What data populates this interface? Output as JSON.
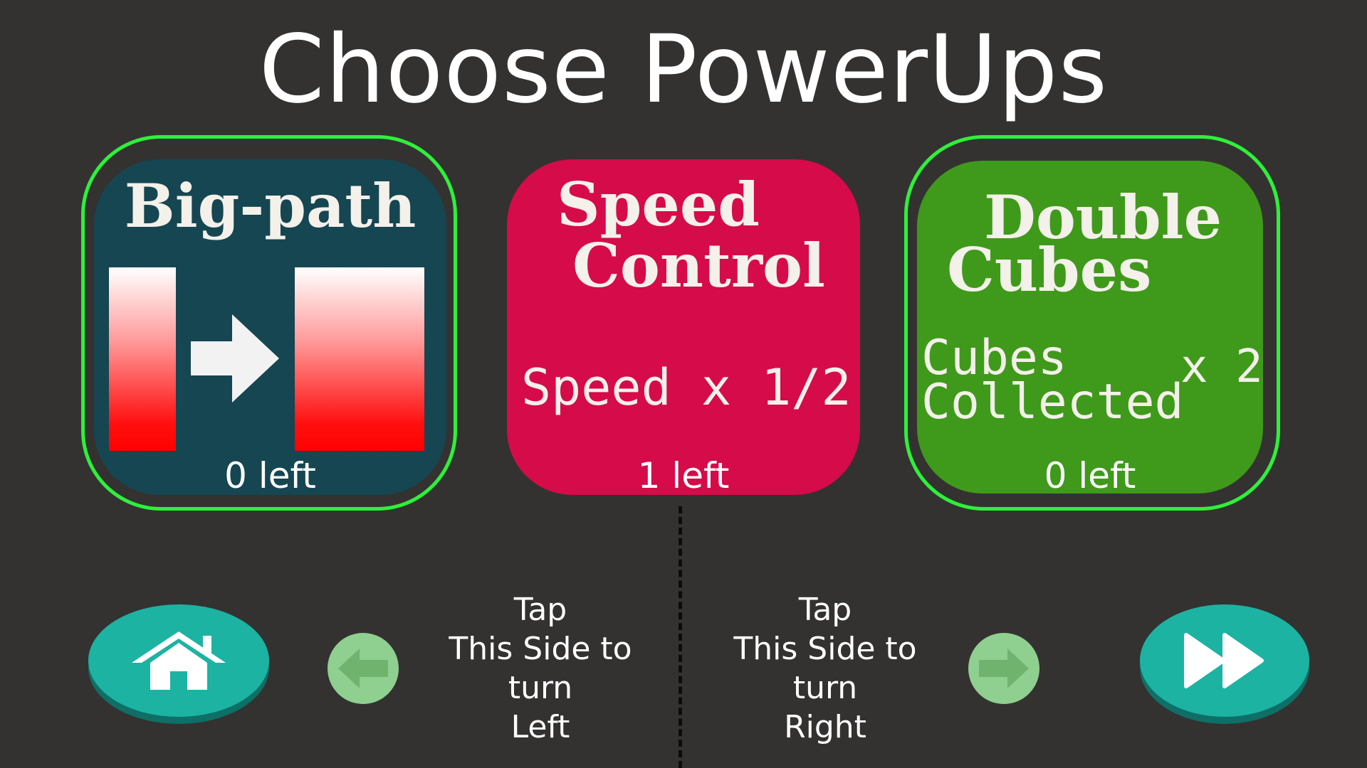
{
  "title": "Choose PowerUps",
  "powerups": [
    {
      "name": "Big-path",
      "count_text": "0 left",
      "color": "#154652"
    },
    {
      "name_line1": "Speed",
      "name_line2": "Control",
      "effect": "Speed x 1/2",
      "count_text": "1 left",
      "color": "#d50b4a"
    },
    {
      "name_line1": "Double",
      "name_line2": "Cubes",
      "effect_line1": "Cubes",
      "effect_line2": "Collected",
      "multiplier": "x 2",
      "count_text": "0 left",
      "color": "#3f9a1b"
    }
  ],
  "hints": {
    "left": {
      "line1": "Tap",
      "line2": "This Side to",
      "line3": "turn",
      "line4": "Left"
    },
    "right": {
      "line1": "Tap",
      "line2": "This Side to",
      "line3": "turn",
      "line4": "Right"
    }
  },
  "icons": {
    "home": "home-icon",
    "left_arrow": "arrow-left-icon",
    "right_arrow": "arrow-right-icon",
    "fast_forward": "fast-forward-icon"
  },
  "colors": {
    "background": "#333231",
    "selection_ring": "#2ef03a",
    "nav_button": "#1cb3a3",
    "arrow_button": "#8fcf8f"
  }
}
